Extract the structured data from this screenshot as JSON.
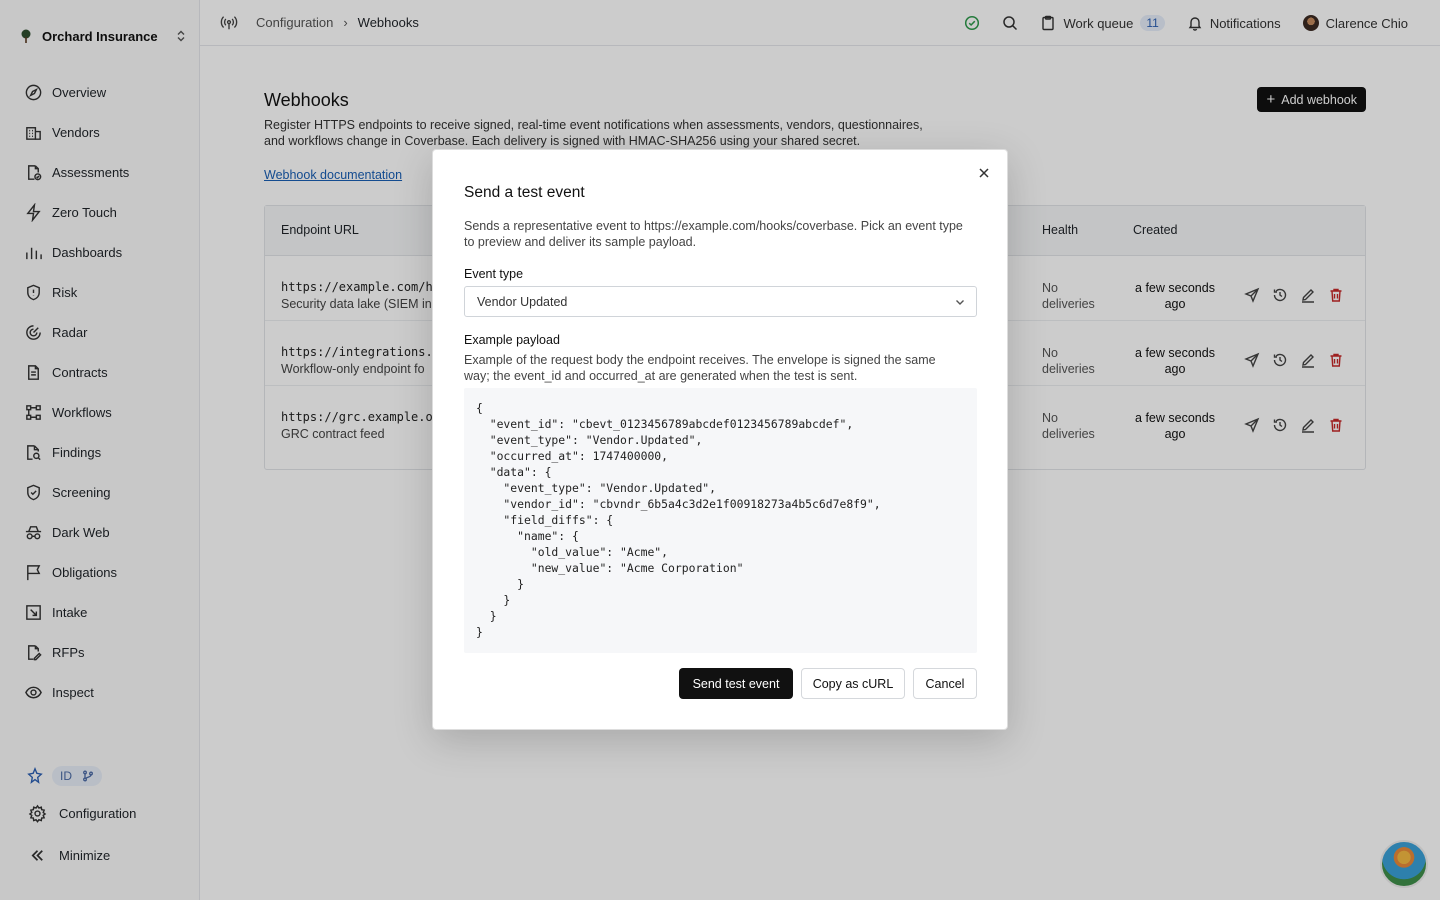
{
  "org": {
    "name": "Orchard Insurance"
  },
  "sidebar": {
    "items": [
      {
        "label": "Overview",
        "icon": "compass-icon"
      },
      {
        "label": "Vendors",
        "icon": "building-icon"
      },
      {
        "label": "Assessments",
        "icon": "file-check-icon"
      },
      {
        "label": "Zero Touch",
        "icon": "bolt-icon"
      },
      {
        "label": "Dashboards",
        "icon": "bar-chart-icon"
      },
      {
        "label": "Risk",
        "icon": "shield-alert-icon"
      },
      {
        "label": "Radar",
        "icon": "radar-icon"
      },
      {
        "label": "Contracts",
        "icon": "document-icon"
      },
      {
        "label": "Workflows",
        "icon": "workflow-icon"
      },
      {
        "label": "Findings",
        "icon": "search-file-icon"
      },
      {
        "label": "Screening",
        "icon": "shield-check-icon"
      },
      {
        "label": "Dark Web",
        "icon": "incognito-icon"
      },
      {
        "label": "Obligations",
        "icon": "flag-icon"
      },
      {
        "label": "Intake",
        "icon": "inbox-arrow-icon"
      },
      {
        "label": "RFPs",
        "icon": "file-edit-icon"
      },
      {
        "label": "Inspect",
        "icon": "eye-icon"
      }
    ],
    "id_pill": "ID",
    "configuration": "Configuration",
    "minimize": "Minimize"
  },
  "topbar": {
    "breadcrumb_parent": "Configuration",
    "breadcrumb_current": "Webhooks",
    "work_queue_label": "Work queue",
    "work_queue_count": "11",
    "notifications_label": "Notifications",
    "user_name": "Clarence Chio"
  },
  "page": {
    "title": "Webhooks",
    "description": "Register HTTPS endpoints to receive signed, real-time event notifications when assessments, vendors, questionnaires, and workflows change in Coverbase. Each delivery is signed with HMAC-SHA256 using your shared secret.",
    "doc_link": "Webhook documentation",
    "add_button": "Add webhook"
  },
  "table": {
    "columns": {
      "endpoint": "Endpoint URL",
      "health": "Health",
      "created": "Created"
    },
    "rows": [
      {
        "url": "https://example.com/h",
        "desc": "Security data lake (SIEM in",
        "health": "No deliveries",
        "created": "a few seconds ago"
      },
      {
        "url": "https://integrations.",
        "desc": "Workflow-only endpoint fo",
        "health": "No deliveries",
        "created": "a few seconds ago"
      },
      {
        "url": "https://grc.example.o",
        "desc": "GRC contract feed",
        "health": "No deliveries",
        "created": "a few seconds ago"
      }
    ]
  },
  "modal": {
    "title": "Send a test event",
    "description": "Sends a representative event to https://example.com/hooks/coverbase. Pick an event type to preview and deliver its sample payload.",
    "event_type_label": "Event type",
    "event_type_value": "Vendor Updated",
    "payload_label": "Example payload",
    "payload_help": "Example of the request body the endpoint receives. The envelope is signed the same way; the event_id and occurred_at are generated when the test is sent.",
    "payload": "{\n  \"event_id\": \"cbevt_0123456789abcdef0123456789abcdef\",\n  \"event_type\": \"Vendor.Updated\",\n  \"occurred_at\": 1747400000,\n  \"data\": {\n    \"event_type\": \"Vendor.Updated\",\n    \"vendor_id\": \"cbvndr_6b5a4c3d2e1f00918273a4b5c6d7e8f9\",\n    \"field_diffs\": {\n      \"name\": {\n        \"old_value\": \"Acme\",\n        \"new_value\": \"Acme Corporation\"\n      }\n    }\n  }\n}",
    "send_button": "Send test event",
    "curl_button": "Copy as cURL",
    "cancel_button": "Cancel"
  }
}
